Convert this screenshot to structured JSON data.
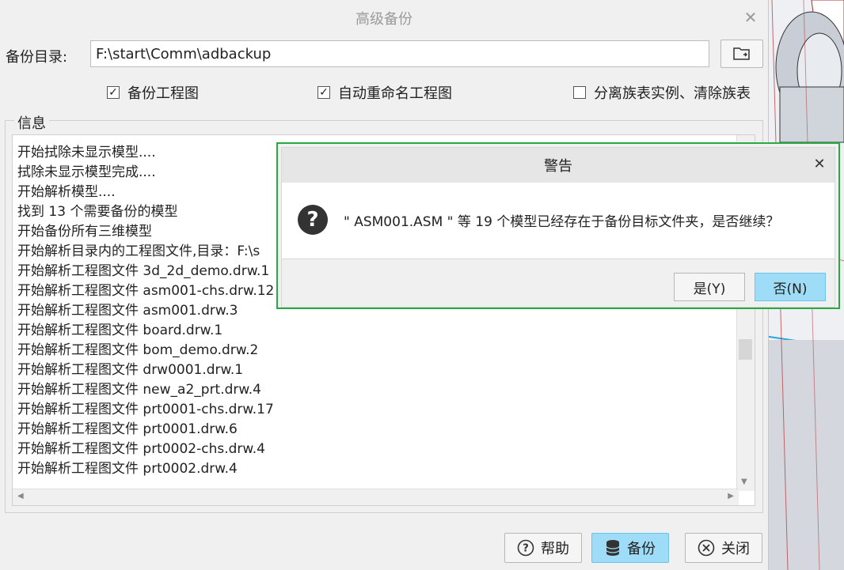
{
  "main": {
    "title": "高级备份",
    "dir_label": "备份目录:",
    "dir_value": "F:\\start\\Comm\\adbackup",
    "options": [
      {
        "label": "备份工程图",
        "checked": true
      },
      {
        "label": "自动重命名工程图",
        "checked": true
      },
      {
        "label": "分离族表实例、清除族表",
        "checked": false
      }
    ],
    "info_label": "信息",
    "log_lines": [
      "开始拭除未显示模型....",
      "拭除未显示模型完成....",
      "开始解析模型....",
      "找到 13 个需要备份的模型",
      "开始备份所有三维模型",
      "开始解析目录内的工程图文件,目录：F:\\s",
      "开始解析工程图文件 3d_2d_demo.drw.1",
      "开始解析工程图文件 asm001-chs.drw.12",
      "开始解析工程图文件 asm001.drw.3",
      "开始解析工程图文件 board.drw.1",
      "开始解析工程图文件 bom_demo.drw.2",
      "开始解析工程图文件 drw0001.drw.1",
      "开始解析工程图文件 new_a2_prt.drw.4",
      "开始解析工程图文件 prt0001-chs.drw.17",
      "开始解析工程图文件 prt0001.drw.6",
      "开始解析工程图文件 prt0002-chs.drw.4",
      "开始解析工程图文件 prt0002.drw.4"
    ],
    "buttons": {
      "help": "帮助",
      "backup": "备份",
      "close": "关闭"
    }
  },
  "warning": {
    "title": "警告",
    "message": "\" ASM001.ASM \" 等 19 个模型已经存在于备份目标文件夹，是否继续？",
    "yes": "是(Y)",
    "no": "否(N)"
  },
  "colors": {
    "accent": "#9fdcf7",
    "highlight_border": "#29a844"
  }
}
